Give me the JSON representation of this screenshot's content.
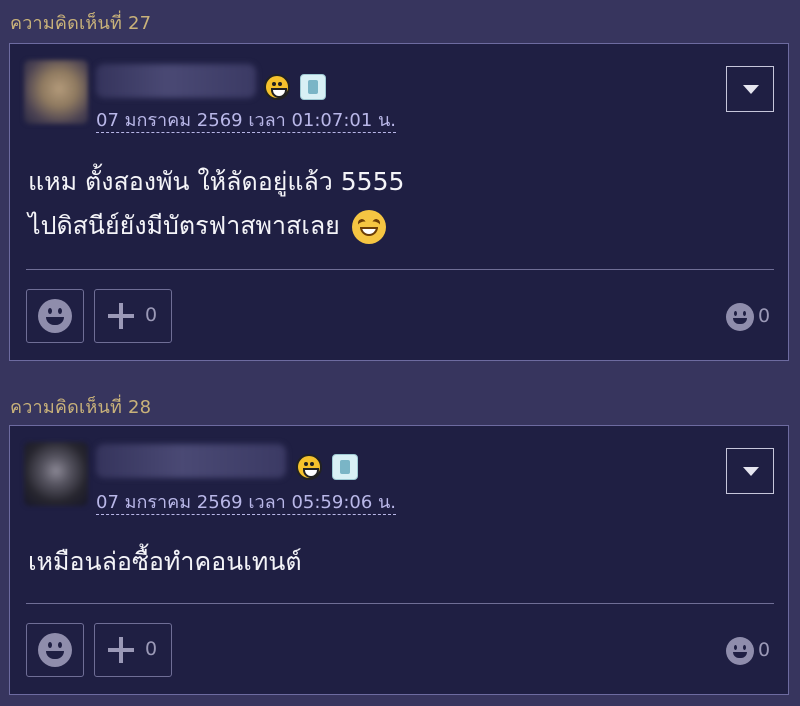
{
  "comments": [
    {
      "header": "ความคิดเห็นที่ 27",
      "timestamp": "07 มกราคม 2569 เวลา 01:07:01 น.",
      "lines": [
        "แหม ตั้งสองพัน ให้ลัดอยู่แล้ว 5555",
        "ไปดิสนีย์ยังมีบัตรฟาสพาสเลย"
      ],
      "plus_count": "0",
      "reaction_count": "0"
    },
    {
      "header": "ความคิดเห็นที่ 28",
      "timestamp": "07 มกราคม 2569 เวลา 05:59:06 น.",
      "lines": [
        "เหมือนล่อซื้อทำคอนเทนต์"
      ],
      "plus_count": "0",
      "reaction_count": "0"
    }
  ],
  "colors": {
    "page_background": "#37355e",
    "card_background": "#1f1f43",
    "header_text": "#c9b27a",
    "timestamp_text": "#b9b7e8"
  }
}
